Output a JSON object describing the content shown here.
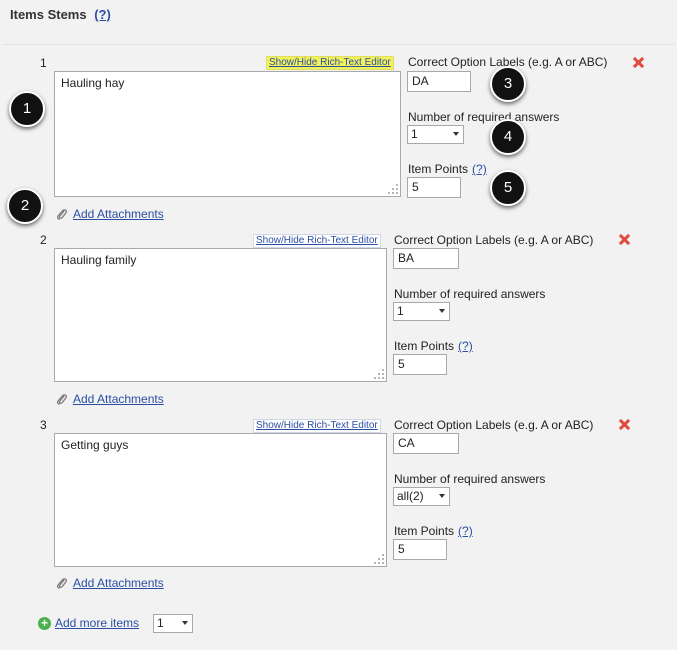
{
  "header": {
    "title": "Items Stems",
    "help": "(?)"
  },
  "rte_label": "Show/Hide Rich-Text Editor",
  "labels": {
    "correct": "Correct Option Labels (e.g. A or ABC)",
    "required": "Number of required answers",
    "points": "Item Points",
    "points_help": "(?)",
    "attach": "Add Attachments"
  },
  "items": [
    {
      "number": "1",
      "stem": "Hauling hay",
      "correct": "DA",
      "required": "1",
      "points": "5"
    },
    {
      "number": "2",
      "stem": "Hauling family",
      "correct": "BA",
      "required": "1",
      "points": "5"
    },
    {
      "number": "3",
      "stem": "Getting guys",
      "correct": "CA",
      "required": "all(2)",
      "points": "5"
    }
  ],
  "footer": {
    "add_more": "Add more items",
    "count": "1"
  },
  "badges": [
    "1",
    "2",
    "3",
    "4",
    "5"
  ],
  "colors": {
    "link": "#2b4ea2",
    "highlight": "#f2f25c",
    "remove": "#e04a3f",
    "add": "#4caf50"
  }
}
